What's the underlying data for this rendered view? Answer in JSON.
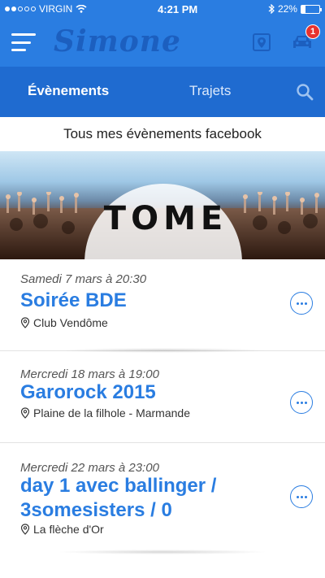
{
  "status_bar": {
    "carrier": "VIRGIN",
    "time": "4:21 PM",
    "battery_text": "22%",
    "battery_level": 0.22
  },
  "nav": {
    "logo_text": "Simone",
    "cart_badge": "1"
  },
  "tabs": [
    {
      "label": "Évènements",
      "active": true
    },
    {
      "label": "Trajets",
      "active": false
    }
  ],
  "section_title": "Tous mes évènements facebook",
  "banner": {
    "logo_text": "TOME"
  },
  "events": [
    {
      "date": "Samedi 7 mars à 20:30",
      "title": "Soirée BDE",
      "place": "Club Vendôme"
    },
    {
      "date": "Mercredi 18 mars à 19:00",
      "title": "Garorock 2015",
      "place": "Plaine de la filhole - Marmande"
    },
    {
      "date": "Mercredi 22 mars à 23:00",
      "title": "day 1 avec ballinger / 3somesisters  / 0",
      "place": "La flèche d'Or"
    }
  ],
  "colors": {
    "accent": "#2a7de1",
    "tab_bar": "#1f6bd0",
    "badge": "#e8322e"
  }
}
